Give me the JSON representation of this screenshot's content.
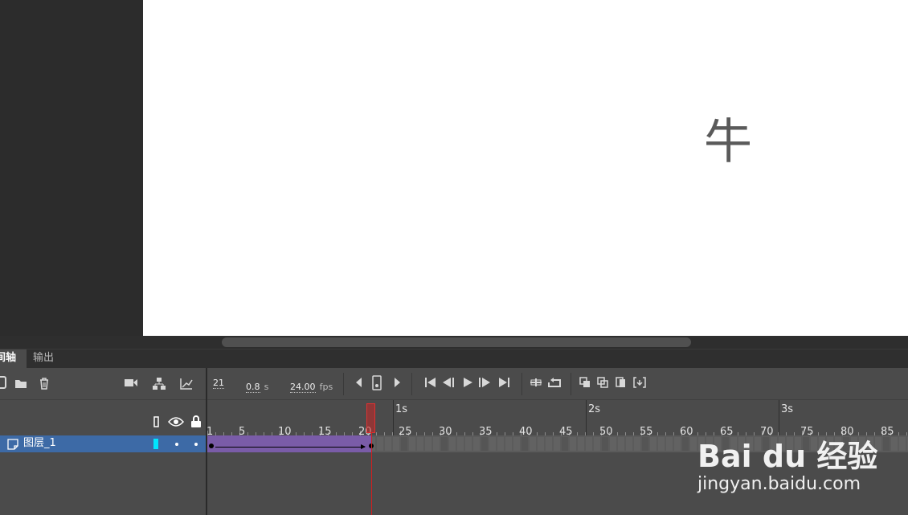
{
  "stage": {
    "text": "牛"
  },
  "tabs": [
    {
      "label": "间轴"
    },
    {
      "label": "输出"
    }
  ],
  "toolbar": {
    "frame": "21",
    "time_value": "0.8",
    "time_unit": "s",
    "fps_value": "24.00",
    "fps_unit": "fps"
  },
  "layer": {
    "name": "图层_1"
  },
  "ruler": {
    "frame_labels": [
      "1",
      "5",
      "10",
      "15",
      "20",
      "25",
      "30",
      "35",
      "40",
      "45",
      "50",
      "55",
      "60",
      "65",
      "70",
      "75",
      "80",
      "85"
    ],
    "second_labels": [
      "1s",
      "2s",
      "3s"
    ]
  },
  "watermark": {
    "logo": "Bai du 经验",
    "url": "jingyan.baidu.com"
  },
  "colors": {
    "tween": "#7a5ca8",
    "playhead": "#d02020",
    "layer_selected": "#3d6aa6"
  }
}
